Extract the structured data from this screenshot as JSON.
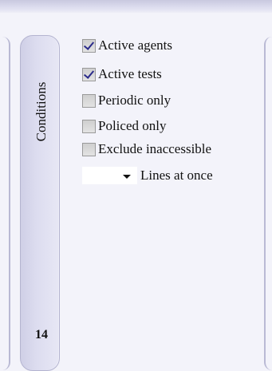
{
  "side_tab": {
    "label": "Conditions",
    "count": "14"
  },
  "options": [
    {
      "label": "Active agents",
      "checked": true
    },
    {
      "label": "Active tests",
      "checked": true
    },
    {
      "label": "Periodic only",
      "checked": false
    },
    {
      "label": "Policed only",
      "checked": false
    },
    {
      "label": "Exclude inaccessible",
      "checked": false
    }
  ],
  "lines_at_once": {
    "value": "",
    "label": "Lines at once"
  },
  "icons": {
    "checkbox_checked": "checkmark-icon",
    "dropdown": "chevron-down-icon"
  }
}
